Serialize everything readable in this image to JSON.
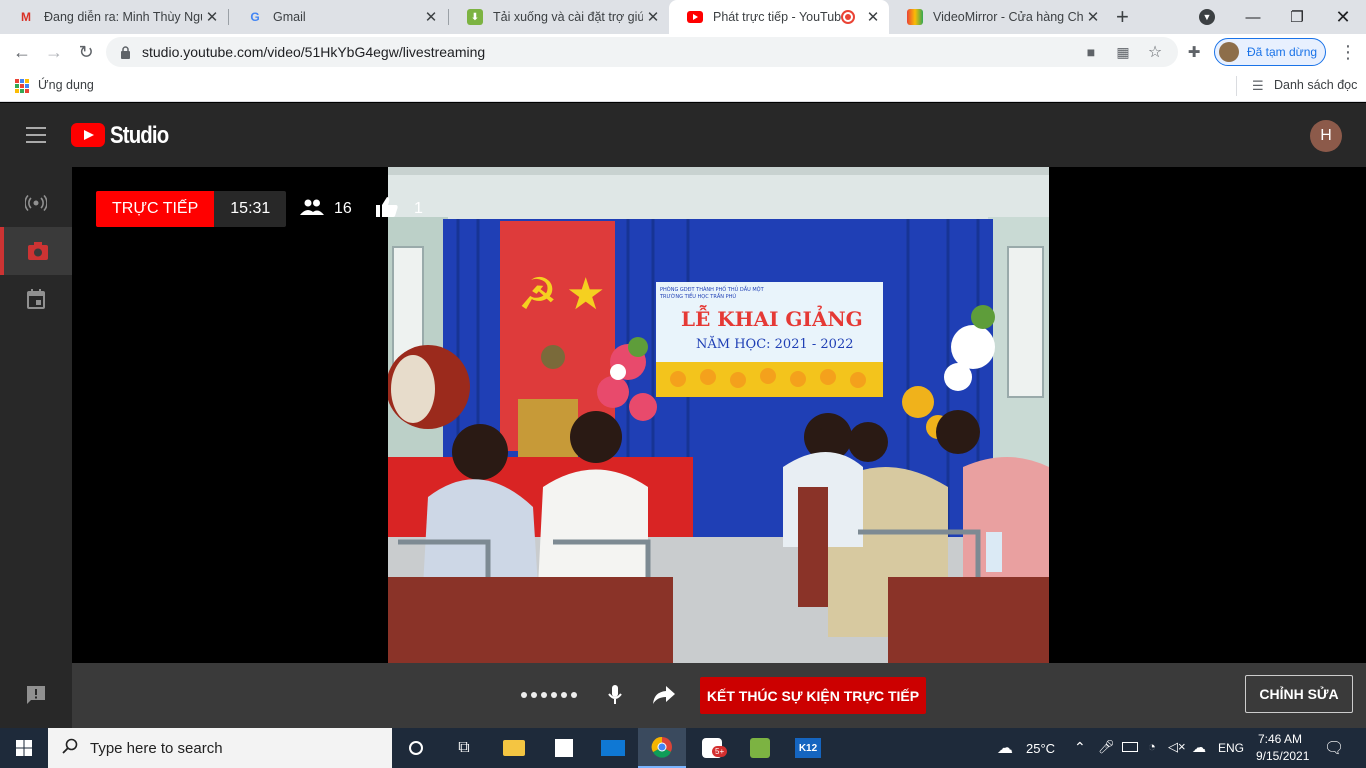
{
  "browser": {
    "tabs": [
      {
        "title": "Đang diễn ra: Minh Thùy Ngu",
        "icon": "gmail-icon"
      },
      {
        "title": "Gmail",
        "icon": "google-icon"
      },
      {
        "title": "Tải xuống và cài đặt trợ giúp",
        "icon": "app-icon"
      },
      {
        "title": "Phát trực tiếp - YouTube",
        "icon": "youtube-icon"
      },
      {
        "title": "VideoMirror - Cửa hàng Chrom",
        "icon": "chrome-store-icon"
      }
    ],
    "new_tab": "+",
    "url": "studio.youtube.com/video/51HkYbG4egw/livestreaming",
    "profile_status": "Đã tạm dừng",
    "bookmarks_apps": "Ứng dụng",
    "reading_list": "Danh sách đọc"
  },
  "studio": {
    "brand": "Studio",
    "avatar_letter": "H",
    "live_badge": "TRỰC TIẾP",
    "elapsed": "15:31",
    "viewers": "16",
    "likes": "1",
    "end_button": "KẾT THÚC SỰ KIỆN TRỰC TIẾP",
    "edit_button": "CHỈNH SỬA"
  },
  "video_banner": {
    "header_line1": "PHÒNG GDĐT THÀNH PHỐ THỦ DẦU MỘT",
    "header_line2": "TRƯỜNG TIỂU HỌC TRẦN PHÚ",
    "title": "LỄ KHAI GIẢNG",
    "subtitle": "NĂM HỌC: 2021 - 2022"
  },
  "taskbar": {
    "search_placeholder": "Type here to search",
    "weather": "25°C",
    "language": "ENG",
    "time": "7:46 AM",
    "date": "9/15/2021",
    "badge": "5+"
  }
}
